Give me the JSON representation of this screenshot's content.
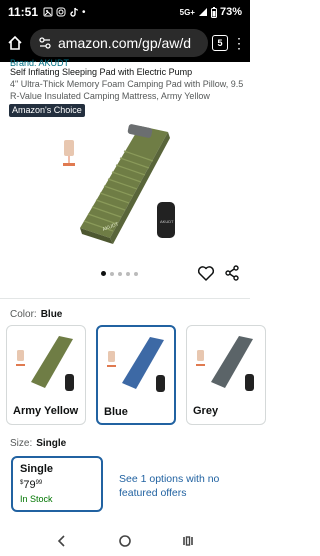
{
  "status_bar": {
    "time": "11:51",
    "network": "5G+",
    "battery": "73%"
  },
  "browser": {
    "url": "amazon.com/gp/aw/d",
    "tab_count": "5"
  },
  "product": {
    "brand": "Brand: AKUDT",
    "title": "Self Inflating Sleeping Pad with Electric Pump",
    "subtitle": "4\" Ultra-Thick Memory Foam Camping Pad with Pillow, 9.5 R-Value Insulated Camping Mattress, Army Yellow",
    "badge": "Amazon's Choice",
    "image_count": 5,
    "active_image": 0
  },
  "color": {
    "label": "Color:",
    "selected": "Blue",
    "options": [
      {
        "name": "Army Yellow",
        "swatch": "#6f7d45"
      },
      {
        "name": "Blue",
        "swatch": "#3d69a5"
      },
      {
        "name": "Grey",
        "swatch": "#5b6468"
      }
    ]
  },
  "size": {
    "label": "Size:",
    "selected": "Single",
    "option": {
      "name": "Single",
      "price_symbol": "$",
      "price_whole": "79",
      "price_fraction": "99",
      "stock": "In Stock"
    },
    "see_options": "See 1 options with no featured offers"
  },
  "colors": {
    "link": "#2162a1",
    "badge_bg": "#232f3e",
    "in_stock": "#007600"
  }
}
